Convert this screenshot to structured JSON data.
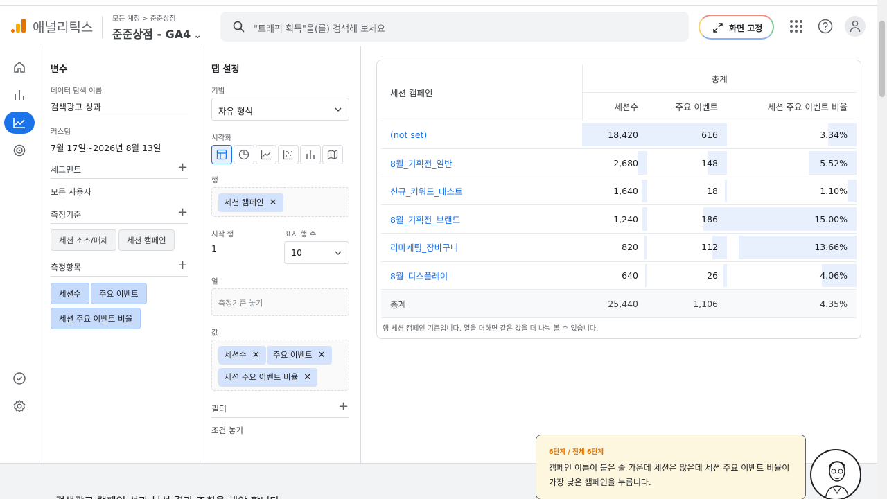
{
  "header": {
    "app_name": "애널리틱스",
    "breadcrumb": "모든 계정 > 준준상점",
    "property": "준준상점 - GA4",
    "search_placeholder": "\"트래픽 획득\"을(를) 검색해 보세요",
    "pin_label": "화면 고정"
  },
  "variables": {
    "title": "변수",
    "explore_name_label": "데이터 탐색 이름",
    "explore_name": "검색광고 성과",
    "date_label": "커스텀",
    "date_value": "7월 17일~2026년 8월 13일",
    "segments_label": "세그먼트",
    "segment_value": "모든 사용자",
    "dimensions_label": "측정기준",
    "dimensions": [
      "세션 소스/매체",
      "세션 캠페인"
    ],
    "metrics_label": "측정항목",
    "metrics": [
      "세션수",
      "주요 이벤트",
      "세션 주요 이벤트 비율"
    ]
  },
  "tab_settings": {
    "title": "탭 설정",
    "technique_label": "기법",
    "technique_value": "자유 형식",
    "visualization_label": "시각화",
    "rows_label": "행",
    "rows_chip": "세션 캠페인",
    "start_row_label": "시작 행",
    "start_row_value": "1",
    "show_rows_label": "표시 행 수",
    "show_rows_value": "10",
    "columns_label": "열",
    "columns_placeholder": "측정기준 놓기",
    "values_label": "값",
    "values": [
      "세션수",
      "주요 이벤트",
      "세션 주요 이벤트 비율"
    ],
    "filters_label": "필터",
    "filters_placeholder": "조건 놓기"
  },
  "table": {
    "group_header": "총계",
    "dimension_header": "세션 캠페인",
    "col_sessions": "세션수",
    "col_key_events": "주요 이벤트",
    "col_rate": "세션 주요 이벤트 비율",
    "rows": [
      {
        "campaign": "(not set)",
        "sessions": "18,420",
        "key_events": "616",
        "rate": "3.34%",
        "sessions_frac": 1.0,
        "events_frac": 1.0,
        "rate_frac": 0.22
      },
      {
        "campaign": "8월_기획전_일반",
        "sessions": "2,680",
        "key_events": "148",
        "rate": "5.52%",
        "sessions_frac": 0.15,
        "events_frac": 0.24,
        "rate_frac": 0.37
      },
      {
        "campaign": "신규_키워드_테스트",
        "sessions": "1,640",
        "key_events": "18",
        "rate": "1.10%",
        "sessions_frac": 0.09,
        "events_frac": 0.03,
        "rate_frac": 0.07
      },
      {
        "campaign": "8월_기획전_브랜드",
        "sessions": "1,240",
        "key_events": "186",
        "rate": "15.00%",
        "sessions_frac": 0.07,
        "events_frac": 0.3,
        "rate_frac": 1.0
      },
      {
        "campaign": "리마케팅_장바구니",
        "sessions": "820",
        "key_events": "112",
        "rate": "13.66%",
        "sessions_frac": 0.04,
        "events_frac": 0.18,
        "rate_frac": 0.91
      },
      {
        "campaign": "8월_디스플레이",
        "sessions": "640",
        "key_events": "26",
        "rate": "4.06%",
        "sessions_frac": 0.03,
        "events_frac": 0.04,
        "rate_frac": 0.27
      }
    ],
    "total_label": "총계",
    "total_sessions": "25,440",
    "total_key_events": "1,106",
    "total_rate": "4.35%",
    "footnote": "행 세션 캠페인 기준입니다. 열을 더하면 같은 값을 더 나눠 볼 수 있습니다."
  },
  "tour": {
    "step": "6단계 / 전체 6단계",
    "message": "캠페인 이름이 붙은 줄 가운데 세션은 많은데 세션 주요 이벤트 비율이 가장 낮은 캠페인을 누릅니다."
  },
  "footer": {
    "partial_text": "검색광고 캠페인 성과 분석 결과 조회을 해야 합니다"
  },
  "colors": {
    "accent": "#1a73e8",
    "bar": "#e8f0fe",
    "tour_bg": "#fef7e0",
    "step": "#e37400"
  }
}
